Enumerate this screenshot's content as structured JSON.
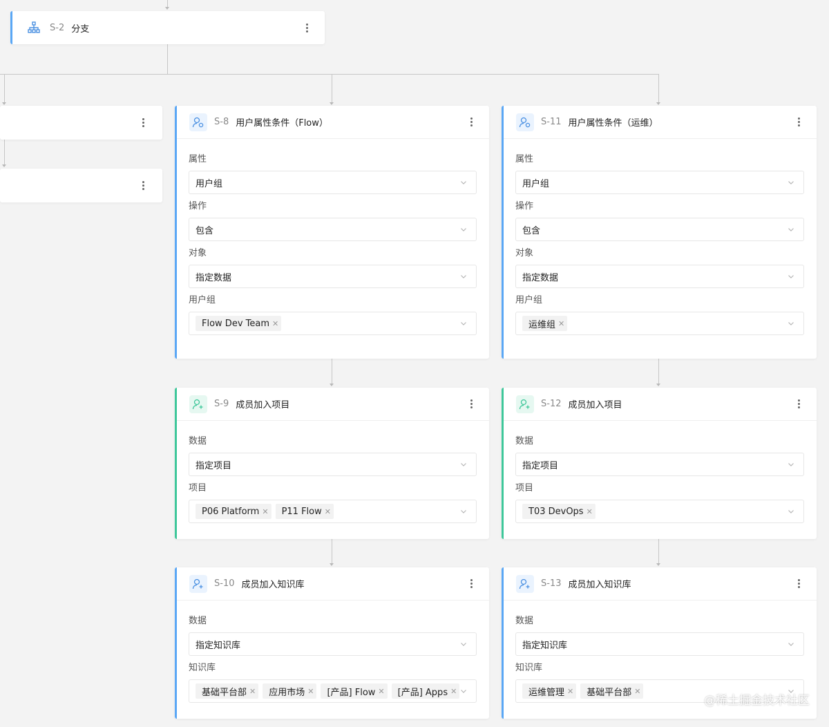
{
  "s2": {
    "code": "S-2",
    "title": "分支",
    "icon": "branch-icon"
  },
  "left1": {
    "icon": "more-icon"
  },
  "left2": {
    "icon": "more-icon"
  },
  "s8": {
    "code": "S-8",
    "title": "用户属性条件（Flow）",
    "icon": "user-attr-icon",
    "fields": [
      {
        "label": "属性",
        "value": "用户组"
      },
      {
        "label": "操作",
        "value": "包含"
      },
      {
        "label": "对象",
        "value": "指定数据"
      },
      {
        "label": "用户组",
        "tags": [
          "Flow Dev Team"
        ]
      }
    ]
  },
  "s11": {
    "code": "S-11",
    "title": "用户属性条件（运维）",
    "icon": "user-attr-icon",
    "fields": [
      {
        "label": "属性",
        "value": "用户组"
      },
      {
        "label": "操作",
        "value": "包含"
      },
      {
        "label": "对象",
        "value": "指定数据"
      },
      {
        "label": "用户组",
        "tags": [
          "运维组"
        ]
      }
    ]
  },
  "s9": {
    "code": "S-9",
    "title": "成员加入项目",
    "icon": "add-member-icon",
    "fields": [
      {
        "label": "数据",
        "value": "指定项目"
      },
      {
        "label": "项目",
        "tags": [
          "P06 Platform",
          "P11 Flow"
        ]
      }
    ]
  },
  "s12": {
    "code": "S-12",
    "title": "成员加入项目",
    "icon": "add-member-icon",
    "fields": [
      {
        "label": "数据",
        "value": "指定项目"
      },
      {
        "label": "项目",
        "tags": [
          "T03 DevOps"
        ]
      }
    ]
  },
  "s10": {
    "code": "S-10",
    "title": "成员加入知识库",
    "icon": "add-member-icon",
    "fields": [
      {
        "label": "数据",
        "value": "指定知识库"
      },
      {
        "label": "知识库",
        "tags": [
          "基础平台部",
          "应用市场",
          "[产品] Flow",
          "[产品] Apps"
        ]
      }
    ]
  },
  "s13": {
    "code": "S-13",
    "title": "成员加入知识库",
    "icon": "add-member-icon",
    "fields": [
      {
        "label": "数据",
        "value": "指定知识库"
      },
      {
        "label": "知识库",
        "tags": [
          "运维管理",
          "基础平台部"
        ]
      }
    ]
  },
  "watermark": "@稀土掘金技术社区",
  "colors": {
    "blue_accent": "#5aa7f5",
    "green_accent": "#3ec79a",
    "background": "#f3f3f3"
  }
}
